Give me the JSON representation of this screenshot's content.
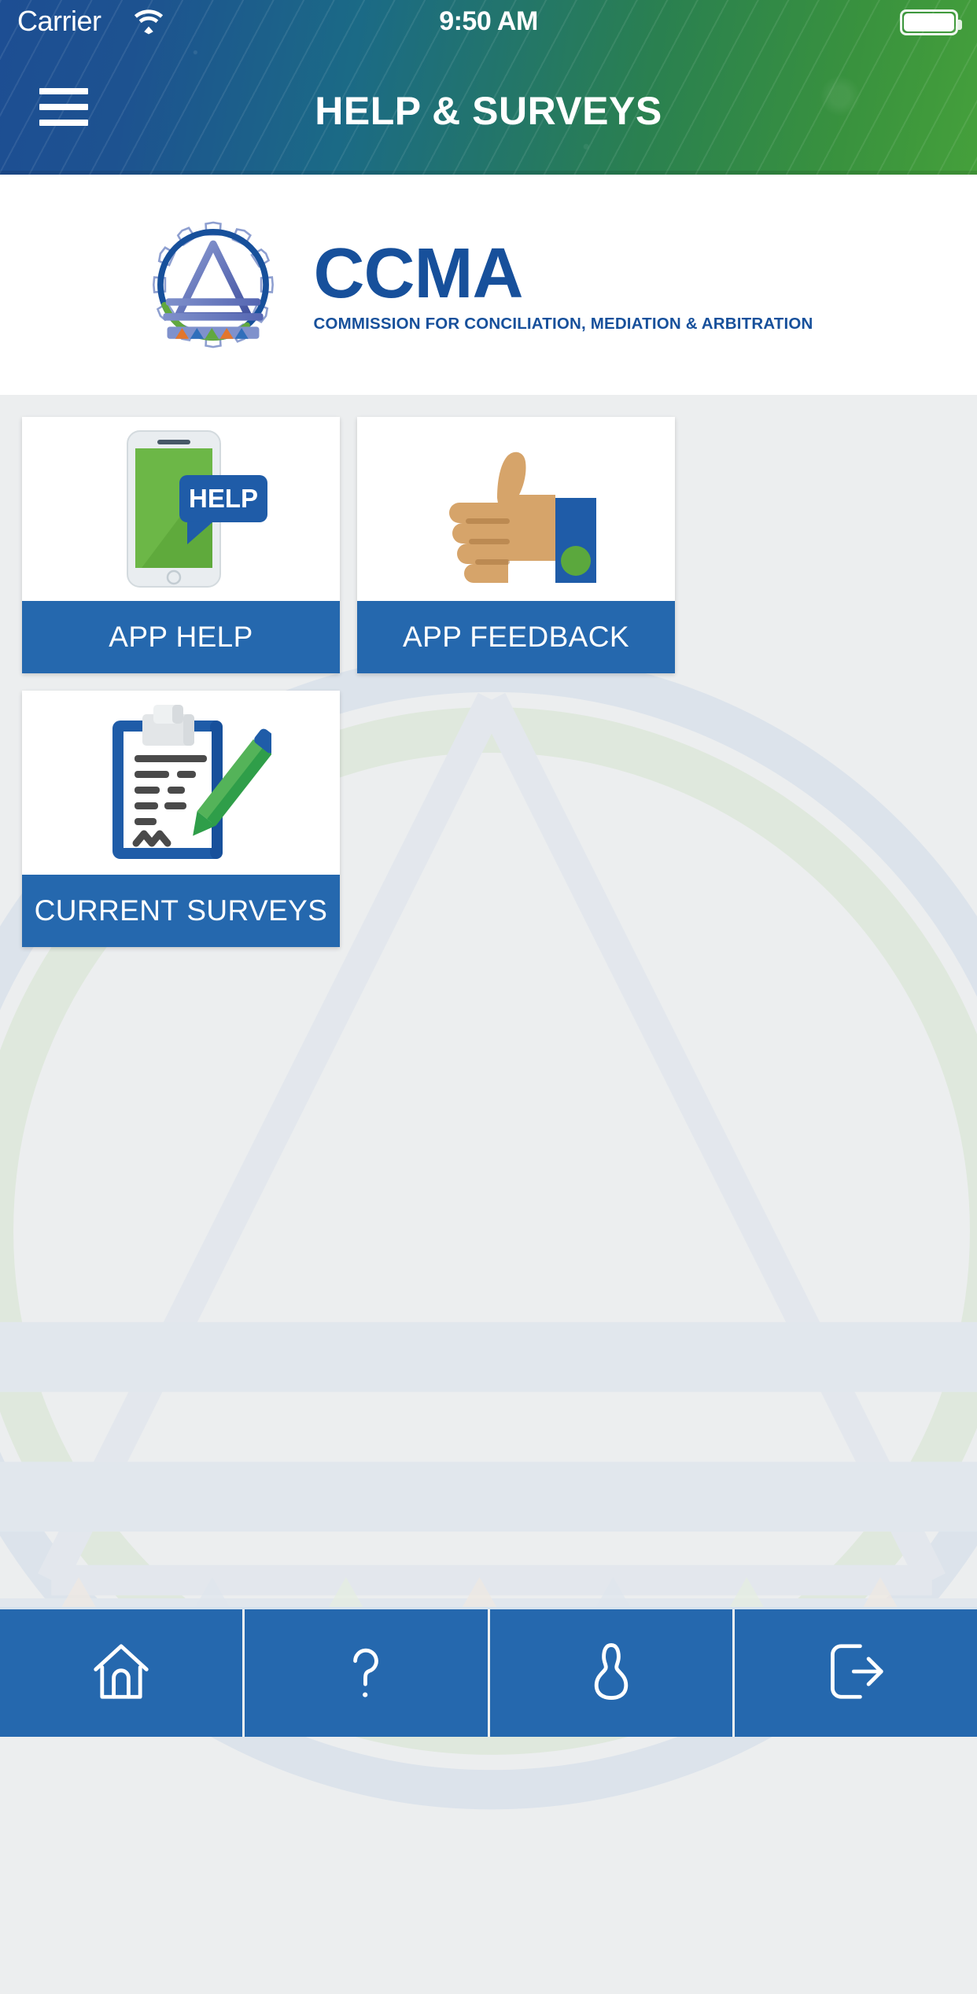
{
  "status_bar": {
    "carrier": "Carrier",
    "time": "9:50 AM",
    "wifi_icon": "wifi-icon",
    "battery_icon": "battery-full-icon"
  },
  "header": {
    "title": "HELP & SURVEYS",
    "menu_icon": "hamburger-menu-icon",
    "gradient_from": "#1d4e93",
    "gradient_to": "#45a03b"
  },
  "brand": {
    "logo_icon": "ccma-logo-icon",
    "wordmark": "CCMA",
    "tagline": "COMMISSION FOR CONCILIATION, MEDIATION & ARBITRATION",
    "brand_blue": "#17509b"
  },
  "theme": {
    "tile_blue": "#2568ae",
    "accent_green": "#5ba83d",
    "page_background": "#eceeef"
  },
  "tiles": [
    {
      "label": "APP HELP",
      "icon": "phone-help-icon",
      "badge_text": "HELP"
    },
    {
      "label": "APP FEEDBACK",
      "icon": "thumbs-up-icon",
      "badge_text": ""
    },
    {
      "label": "CURRENT SURVEYS",
      "icon": "clipboard-pen-icon",
      "badge_text": ""
    }
  ],
  "bottom_nav": [
    {
      "name": "home",
      "icon": "home-icon",
      "label": ""
    },
    {
      "name": "help",
      "icon": "question-mark-icon",
      "label": ""
    },
    {
      "name": "profile",
      "icon": "user-icon",
      "label": ""
    },
    {
      "name": "logout",
      "icon": "logout-icon",
      "label": ""
    }
  ]
}
